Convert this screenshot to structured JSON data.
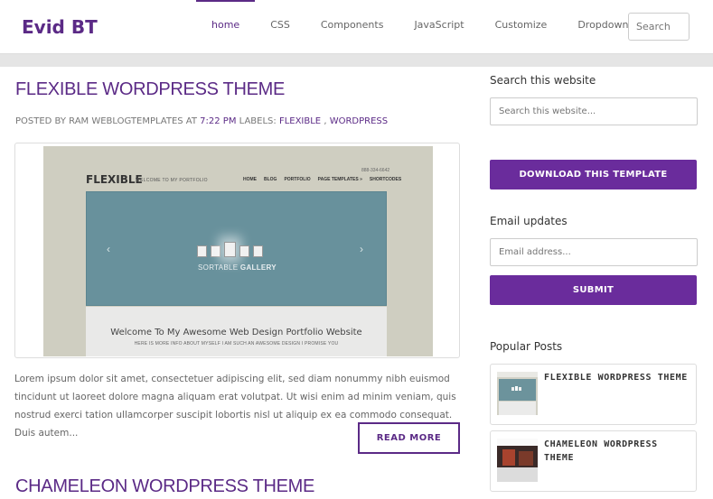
{
  "header": {
    "logo": "Evid BT",
    "nav": [
      {
        "label": "home",
        "active": true
      },
      {
        "label": "CSS"
      },
      {
        "label": "Components"
      },
      {
        "label": "JavaScript"
      },
      {
        "label": "Customize"
      },
      {
        "label": "Dropdown",
        "has_caret": true
      }
    ],
    "search_placeholder": "Search"
  },
  "posts": [
    {
      "title": "FLEXIBLE WORDPRESS THEME",
      "meta": {
        "posted_by": "POSTED BY RAM WEBLOGTEMPLATES AT",
        "time": "7:22 PM",
        "labels_prefix": "LABELS:",
        "labels": [
          "FLEXIBLE",
          "WORDPRESS"
        ],
        "label_separator": " , "
      },
      "thumbnail": {
        "logo": "FLEXIBLE",
        "tagline": "WELCOME TO MY PORTFOLIO",
        "phone": "888-334-6642",
        "nav": [
          "HOME",
          "BLOG",
          "PORTFOLIO",
          "PAGE TEMPLATES »",
          "SHORTCODES"
        ],
        "slider_text_light": "SORTABLE",
        "slider_text_bold": "GALLERY",
        "arrow_left": "‹",
        "arrow_right": "›",
        "welcome": "Welcome To My Awesome Web Design Portfolio Website",
        "subtext": "HERE IS MORE INFO ABOUT MYSELF I AM SUCH AN AWESOME DESIGN I PROMISE YOU"
      },
      "excerpt": "Lorem ipsum dolor sit amet, consectetuer adipiscing elit, sed diam nonummy nibh euismod tincidunt ut laoreet dolore magna aliquam erat volutpat. Ut wisi enim ad minim veniam, quis nostrud exerci tation ullamcorper suscipit lobortis nisl ut aliquip ex ea commodo consequat. Duis autem...",
      "read_more": "READ MORE"
    },
    {
      "title": "CHAMELEON WORDPRESS THEME"
    }
  ],
  "sidebar": {
    "search": {
      "heading": "Search this website",
      "placeholder": "Search this website..."
    },
    "download_button": "DOWNLOAD THIS TEMPLATE",
    "email": {
      "heading": "Email updates",
      "placeholder": "Email address...",
      "submit": "SUBMIT"
    },
    "popular": {
      "heading": "Popular Posts",
      "items": [
        {
          "title": "FLEXIBLE WORDPRESS THEME"
        },
        {
          "title": "CHAMELEON WORDPRESS THEME"
        }
      ]
    }
  },
  "colors": {
    "brand": "#5b2a86",
    "button": "#6a2c9c",
    "page_bg": "#e5e5e5"
  }
}
